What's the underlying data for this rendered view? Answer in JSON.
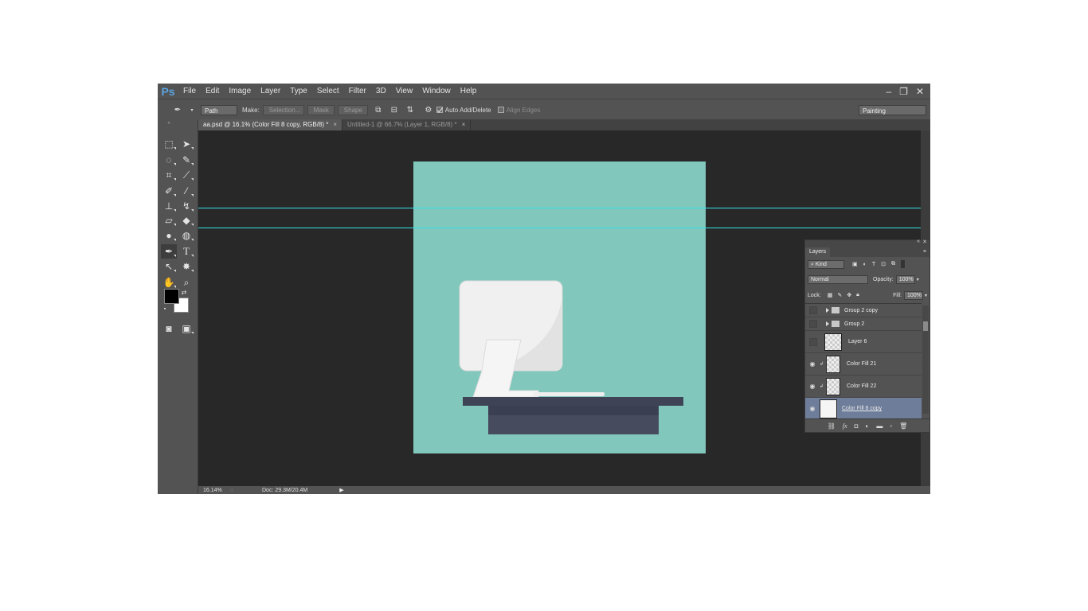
{
  "app": {
    "logo": "Ps"
  },
  "menu": [
    "File",
    "Edit",
    "Image",
    "Layer",
    "Type",
    "Select",
    "Filter",
    "3D",
    "View",
    "Window",
    "Help"
  ],
  "window_controls": {
    "minimize": "–",
    "restore": "❐",
    "close": "✕"
  },
  "options": {
    "tool_mode": "Path",
    "make_label": "Make:",
    "selection_btn": "Selection...",
    "mask_btn": "Mask",
    "shape_btn": "Shape",
    "auto_add_delete": "Auto Add/Delete",
    "align_edges": "Align Edges",
    "workspace": "Painting"
  },
  "tabs": [
    {
      "label": "aa.psd @ 16.1% (Color Fill 8 copy, RGB/8) *",
      "close": "×"
    },
    {
      "label": "Untitled-1 @ 66.7% (Layer 1, RGB/8) *",
      "close": "×"
    }
  ],
  "status": {
    "zoom": "16.14%",
    "doc": "Doc: 29.3M/20.4M"
  },
  "layers": {
    "panel_title": "Layers",
    "filter_kind": "Kind",
    "blend_mode": "Normal",
    "opacity_label": "Opacity:",
    "opacity_value": "100%",
    "lock_label": "Lock:",
    "fill_label": "Fill:",
    "fill_value": "100%",
    "items": [
      {
        "name": "Group 2 copy",
        "type": "group",
        "visible": false
      },
      {
        "name": "Group 2",
        "type": "group",
        "visible": false
      },
      {
        "name": "Layer 6",
        "type": "layer",
        "visible": false
      },
      {
        "name": "Color Fill 21",
        "type": "fill",
        "visible": true
      },
      {
        "name": "Color Fill 22",
        "type": "fill",
        "visible": true
      },
      {
        "name": "Color Fill 8 copy",
        "type": "fill",
        "visible": true,
        "selected": true
      }
    ]
  },
  "colors": {
    "canvas_bg": "#81c7bc",
    "guide": "#34dfe6",
    "desk": "#3f4356",
    "monitor": "#f0f0f0"
  }
}
